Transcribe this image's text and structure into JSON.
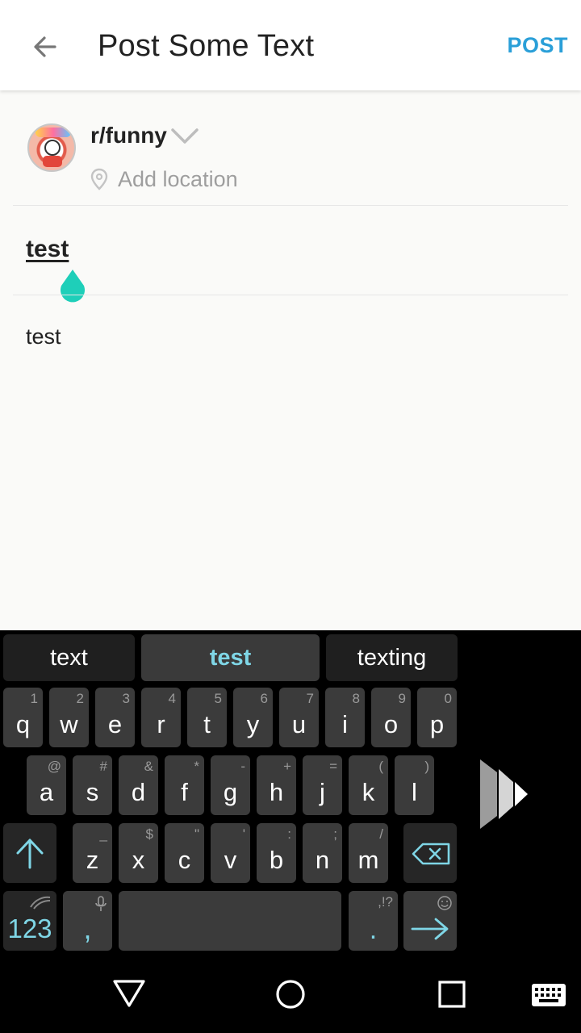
{
  "header": {
    "title": "Post Some Text",
    "post_label": "POST"
  },
  "form": {
    "subreddit": "r/funny",
    "location_placeholder": "Add location",
    "post_title": "test",
    "post_body": "test"
  },
  "keyboard": {
    "suggestions": [
      "text",
      "test",
      "texting"
    ],
    "row1": [
      {
        "k": "q",
        "s": "1"
      },
      {
        "k": "w",
        "s": "2"
      },
      {
        "k": "e",
        "s": "3"
      },
      {
        "k": "r",
        "s": "4"
      },
      {
        "k": "t",
        "s": "5"
      },
      {
        "k": "y",
        "s": "6"
      },
      {
        "k": "u",
        "s": "7"
      },
      {
        "k": "i",
        "s": "8"
      },
      {
        "k": "o",
        "s": "9"
      },
      {
        "k": "p",
        "s": "0"
      }
    ],
    "row2": [
      {
        "k": "a",
        "s": "@"
      },
      {
        "k": "s",
        "s": "#"
      },
      {
        "k": "d",
        "s": "&"
      },
      {
        "k": "f",
        "s": "*"
      },
      {
        "k": "g",
        "s": "-"
      },
      {
        "k": "h",
        "s": "+"
      },
      {
        "k": "j",
        "s": "="
      },
      {
        "k": "k",
        "s": "("
      },
      {
        "k": "l",
        "s": ")"
      }
    ],
    "row3": [
      {
        "k": "z",
        "s": "_"
      },
      {
        "k": "x",
        "s": "$"
      },
      {
        "k": "c",
        "s": "\""
      },
      {
        "k": "v",
        "s": "'"
      },
      {
        "k": "b",
        "s": ":"
      },
      {
        "k": "n",
        "s": ";"
      },
      {
        "k": "m",
        "s": "/"
      }
    ],
    "numbers_label": "123",
    "comma_label": ",",
    "period_label": ".",
    "period_sub": ",!?"
  },
  "colors": {
    "accent": "#2a9fd8",
    "keyboard_accent": "#7fd6e6",
    "cursor": "#1ecfb9"
  }
}
